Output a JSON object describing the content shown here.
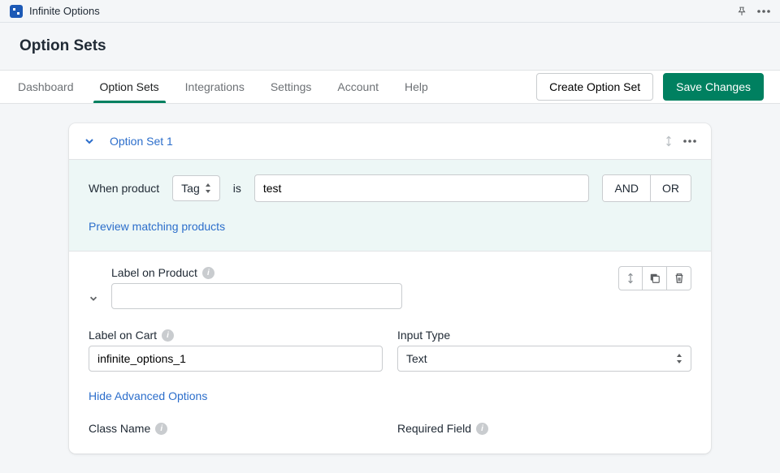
{
  "topbar": {
    "app_name": "Infinite Options"
  },
  "header": {
    "title": "Option Sets"
  },
  "nav": {
    "tabs": [
      "Dashboard",
      "Option Sets",
      "Integrations",
      "Settings",
      "Account",
      "Help"
    ],
    "active_index": 1,
    "create_btn": "Create Option Set",
    "save_btn": "Save Changes"
  },
  "card": {
    "set_title": "Option Set 1",
    "rule": {
      "prefix": "When product",
      "selector": "Tag",
      "mid": "is",
      "value": "test",
      "and": "AND",
      "or": "OR",
      "preview_link": "Preview matching products"
    },
    "fields": {
      "label_product": "Label on Product",
      "label_product_value": "",
      "label_cart": "Label on Cart",
      "label_cart_value": "infinite_options_1",
      "input_type": "Input Type",
      "input_type_value": "Text",
      "adv_link": "Hide Advanced Options",
      "class_name": "Class Name",
      "required_field": "Required Field"
    }
  }
}
